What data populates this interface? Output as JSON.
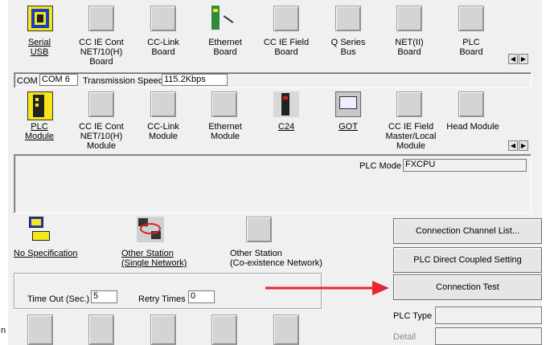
{
  "pc_side": {
    "items": [
      {
        "label": "Serial\nUSB",
        "icon": "serial-usb-icon",
        "selected": true
      },
      {
        "label": "CC IE Cont\nNET/10(H)\nBoard",
        "icon": "blank-icon"
      },
      {
        "label": "CC-Link\nBoard",
        "icon": "blank-icon"
      },
      {
        "label": "Ethernet\nBoard",
        "icon": "ethernet-board-icon"
      },
      {
        "label": "CC IE Field\nBoard",
        "icon": "blank-icon"
      },
      {
        "label": "Q Series\nBus",
        "icon": "blank-icon"
      },
      {
        "label": "NET(II)\nBoard",
        "icon": "blank-icon"
      },
      {
        "label": "PLC\nBoard",
        "icon": "blank-icon"
      }
    ],
    "com_label": "COM",
    "com_value": "COM 6",
    "speed_label": "Transmission Speed",
    "speed_value": "115.2Kbps"
  },
  "plc_side": {
    "items": [
      {
        "label": "PLC\nModule",
        "icon": "plc-module-icon",
        "selected": true
      },
      {
        "label": "CC IE Cont\nNET/10(H)\nModule",
        "icon": "blank-icon"
      },
      {
        "label": "CC-Link\nModule",
        "icon": "blank-icon"
      },
      {
        "label": "Ethernet\nModule",
        "icon": "blank-icon"
      },
      {
        "label": "C24",
        "icon": "c24-icon"
      },
      {
        "label": "GOT",
        "icon": "got-icon"
      },
      {
        "label": "CC IE Field\nMaster/Local\nModule",
        "icon": "blank-icon"
      },
      {
        "label": "Head Module",
        "icon": "blank-icon"
      }
    ],
    "plc_mode_label": "PLC Mode",
    "plc_mode_value": "FXCPU"
  },
  "other_station": {
    "items": [
      {
        "label": "No Specification"
      },
      {
        "label": "Other Station\n(Single Network)"
      },
      {
        "label": "Other Station\n(Co-existence Network)"
      }
    ],
    "timeout_label": "Time Out (Sec.)",
    "timeout_value": "5",
    "retry_label": "Retry Times",
    "retry_value": "0"
  },
  "buttons": {
    "channel_list": "Connection Channel List...",
    "direct_coupled": "PLC Direct Coupled Setting",
    "connection_test": "Connection Test"
  },
  "plc_type_label": "PLC Type",
  "detail_label": "Detail",
  "side_char": "n",
  "colors": {
    "arrow": "#e8272b",
    "yellow": "#f5e61a",
    "blue": "#1a3cc8"
  }
}
